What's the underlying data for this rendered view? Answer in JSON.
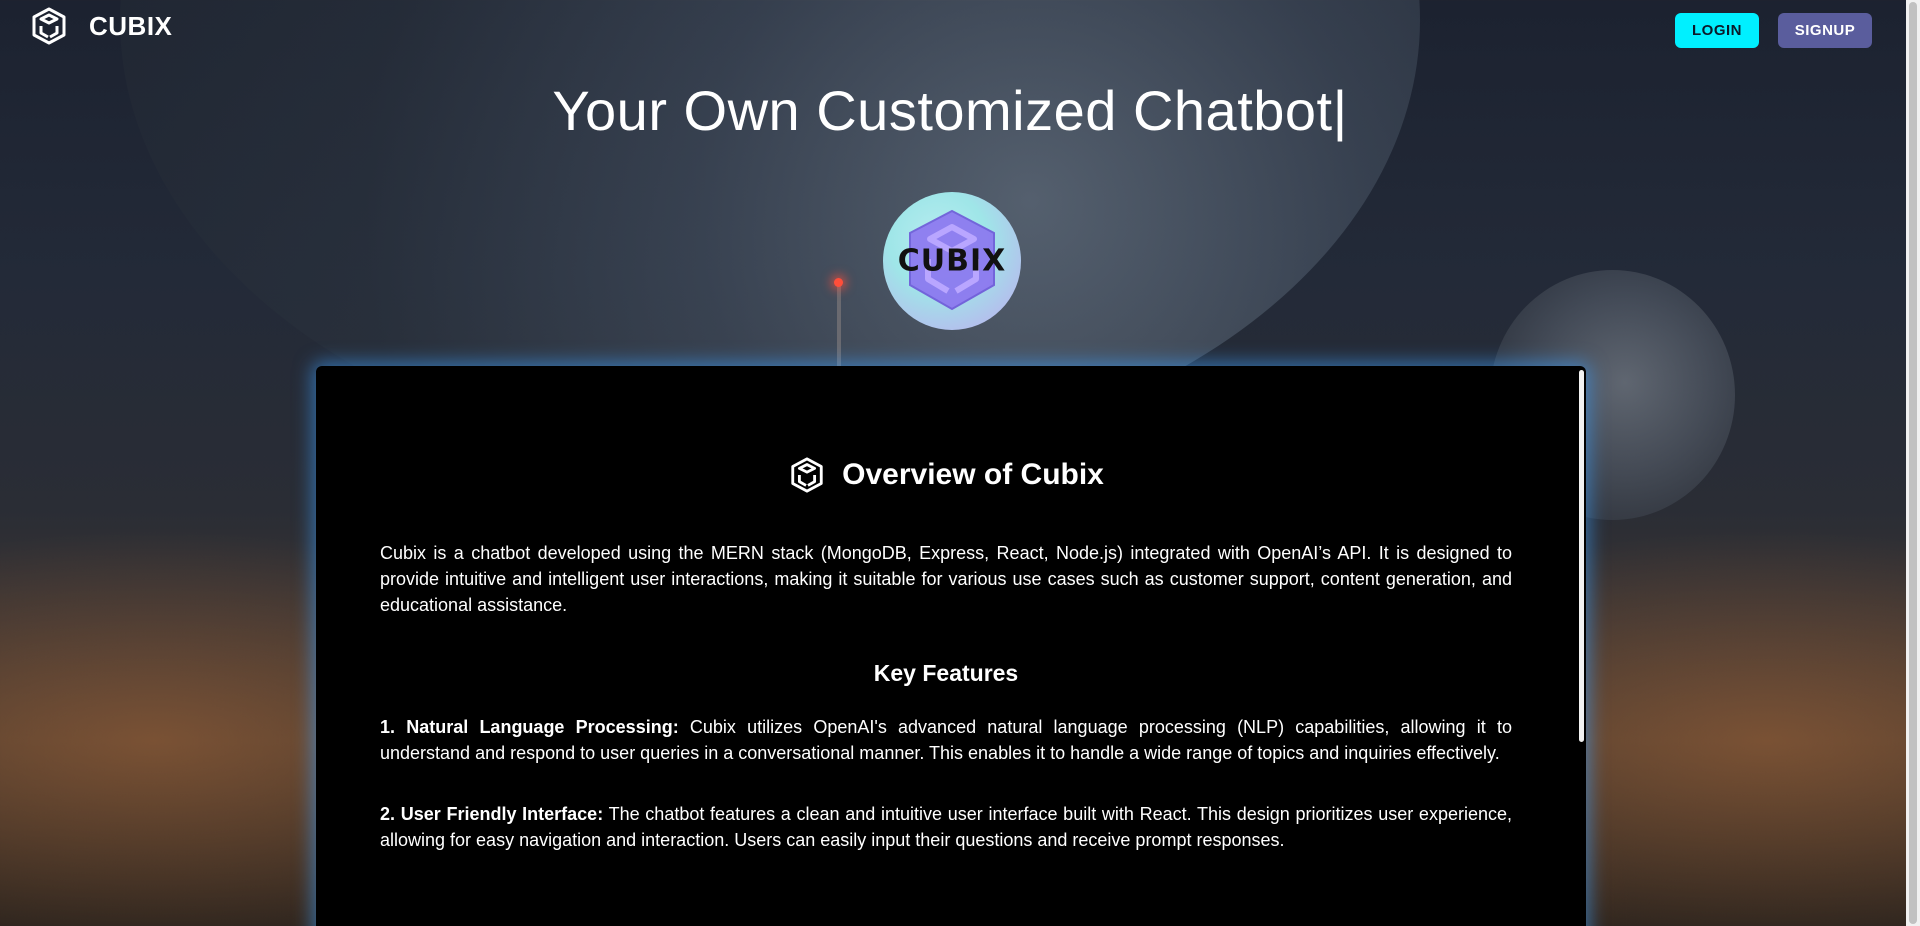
{
  "navbar": {
    "brand_name": "CUBIX",
    "login_label": "LOGIN",
    "signup_label": "SIGNUP"
  },
  "hero": {
    "title": "Your Own Customized Chatbot|",
    "logo_text": "CUBIX"
  },
  "overview": {
    "heading": "Overview of Cubix",
    "intro": "Cubix is a chatbot developed using the MERN stack (MongoDB, Express, React, Node.js) integrated with OpenAI’s API. It is designed to provide intuitive and intelligent user interactions, making it suitable for various use cases such as customer support, content generation, and educational assistance.",
    "features_title": "Key Features",
    "features": [
      {
        "title": "1. Natural Language Processing:",
        "text": " Cubix utilizes OpenAI's advanced natural language processing (NLP) capabilities, allowing it to understand and respond to user queries in a conversational manner. This enables it to handle a wide range of topics and inquiries effectively."
      },
      {
        "title": "2. User Friendly Interface:",
        "text": " The chatbot features a clean and intuitive user interface built with React. This design prioritizes user experience, allowing for easy navigation and interaction. Users can easily input their questions and receive prompt responses."
      }
    ]
  },
  "colors": {
    "login_bg": "#00f0ff",
    "signup_bg": "#5a5d9d",
    "panel_glow": "#3ca0ff"
  },
  "icons": {
    "brand": "cube-logo-icon",
    "heading": "cube-logo-icon"
  }
}
